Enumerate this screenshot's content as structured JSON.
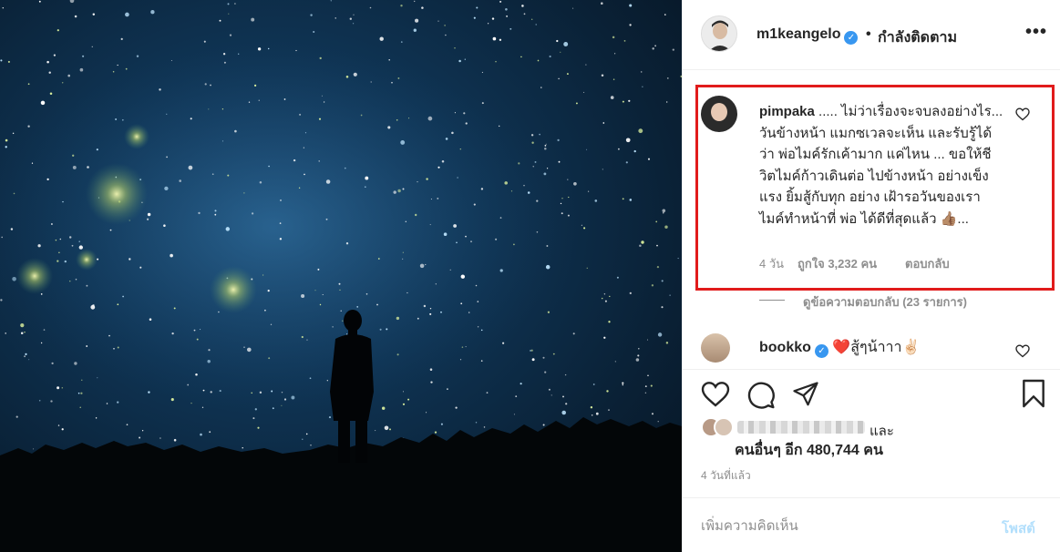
{
  "post": {
    "author": "m1keangelo",
    "separator": "•",
    "follow_status": "กำลังติดตาม",
    "more": "•••"
  },
  "highlighted_comment": {
    "username": "pimpaka",
    "text": "..... ไม่ว่าเรื่องจะจบลงอย่างไร... วันข้างหน้า แมกซเวลจะเห็น และรับรู้ได้ ว่า พ่อไมค์รักเค้ามาก แค่ไหน ... ขอให้ชีวิตไมค์ก้าวเดินต่อ ไปข้างหน้า อย่างเข็งแรง ยิ้มสู้กับทุก อย่าง เฝ้ารอวันของเรา ไมค์ทำหน้าที่ พ่อ ได้ดีที่สุดแล้ว 👍🏽...",
    "time": "4 วัน",
    "likes": "ถูกใจ 3,232 คน",
    "reply": "ตอบกลับ",
    "view_replies": "ดูข้อความตอบกลับ (23 รายการ)",
    "highlight_color": "#e11b1b"
  },
  "second_comment": {
    "username": "bookko",
    "text": "❤️สู้ๆน้าาา✌🏻"
  },
  "likes": {
    "and": "และ",
    "others": "คนอื่นๆ อีก 480,744 คน"
  },
  "timestamp": "4 วันที่แล้ว",
  "comment_box": {
    "placeholder": "เพิ่มความคิดเห็น",
    "post_label": "โพสต์"
  },
  "icons": {
    "header_avatar": "profile-avatar",
    "like": "heart-icon",
    "comment": "comment-icon",
    "share": "paper-plane-icon",
    "save": "bookmark-icon"
  },
  "colors": {
    "verified": "#3897f0",
    "muted": "#8e8e8e",
    "post_disabled": "#b2dffc"
  }
}
